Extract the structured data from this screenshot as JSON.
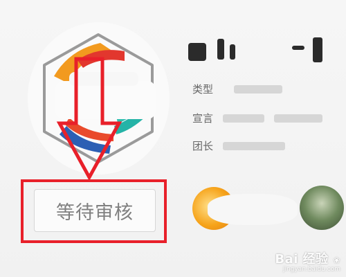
{
  "group": {
    "title": "",
    "type_label": "类型",
    "type_value": "",
    "slogan_label": "宣言",
    "slogan_value": "",
    "leader_label": "团长",
    "leader_value": ""
  },
  "actions": {
    "pending_label": "等待审核"
  },
  "annotation": {
    "color": "#e8202a"
  },
  "watermark": {
    "brand": "Bai 经验",
    "site": "jingyan.baidu.com"
  },
  "icons": [
    "group-avatar-icon",
    "paw-icon"
  ]
}
